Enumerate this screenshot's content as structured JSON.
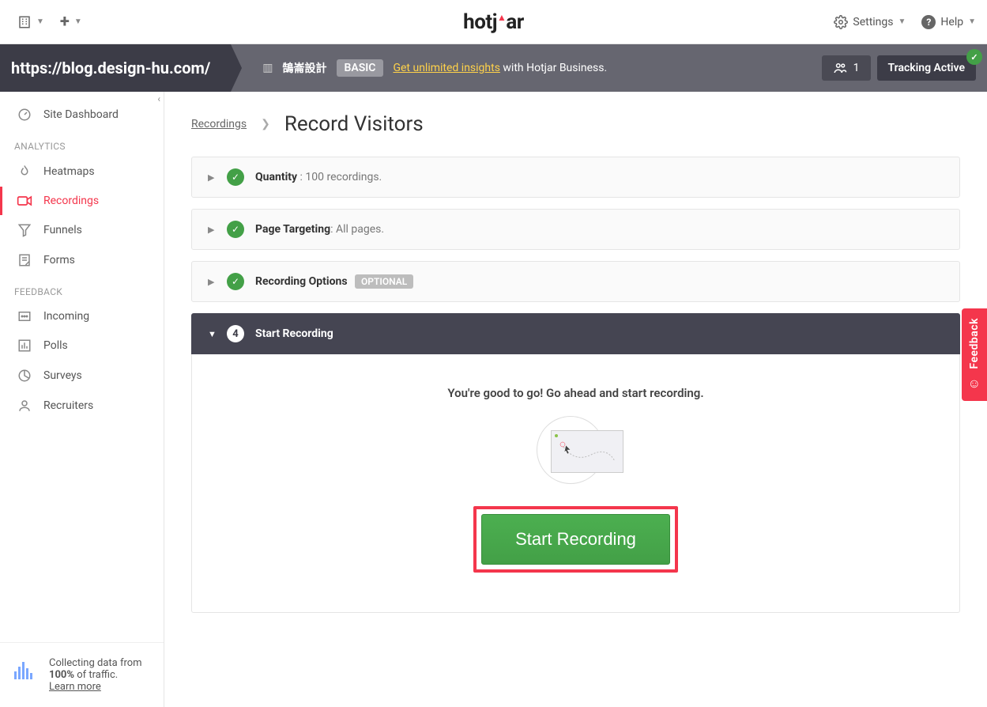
{
  "header": {
    "settings_label": "Settings",
    "help_label": "Help",
    "logo": "hotjar"
  },
  "sitebar": {
    "url": "https://blog.design-hu.com/",
    "org_name": "鵠崙設計",
    "plan_badge": "BASIC",
    "upgrade_link": "Get unlimited insights",
    "upgrade_suffix": " with Hotjar Business.",
    "users_count": "1",
    "tracking_label": "Tracking Active"
  },
  "sidebar": {
    "dashboard": "Site Dashboard",
    "section_analytics": "ANALYTICS",
    "heatmaps": "Heatmaps",
    "recordings": "Recordings",
    "funnels": "Funnels",
    "forms": "Forms",
    "section_feedback": "FEEDBACK",
    "incoming": "Incoming",
    "polls": "Polls",
    "surveys": "Surveys",
    "recruiters": "Recruiters",
    "footer_line1": "Collecting data from",
    "footer_bold": "100%",
    "footer_line2_suffix": " of traffic.",
    "footer_learn": "Learn more"
  },
  "breadcrumb": {
    "root": "Recordings",
    "title": "Record Visitors"
  },
  "panels": {
    "quantity_label": "Quantity",
    "quantity_value": " : 100 recordings.",
    "targeting_label": "Page Targeting",
    "targeting_value": ": All pages.",
    "options_label": "Recording Options",
    "options_badge": "OPTIONAL",
    "start_step_num": "4",
    "start_label": "Start Recording",
    "ready_text": "You're good to go! Go ahead and start recording.",
    "start_button": "Start Recording"
  },
  "feedback_tab": "Feedback"
}
